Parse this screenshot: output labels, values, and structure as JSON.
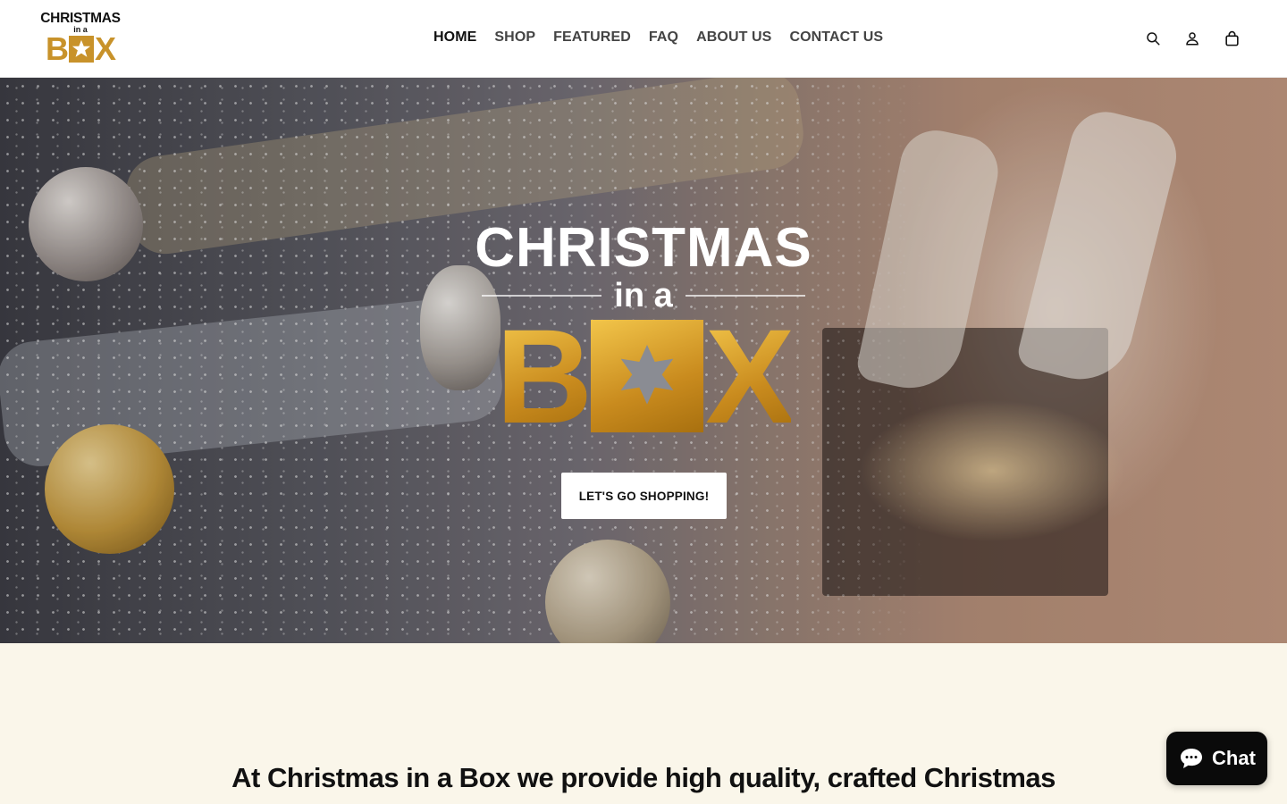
{
  "brand": {
    "logo_line1": "CHRISTMAS",
    "logo_line2": "in a",
    "logo_box_left": "B",
    "logo_box_right": "X",
    "gold_color": "#c8922a"
  },
  "nav": {
    "items": [
      {
        "label": "HOME",
        "active": true
      },
      {
        "label": "SHOP"
      },
      {
        "label": "FEATURED"
      },
      {
        "label": "FAQ"
      },
      {
        "label": "ABOUT US"
      },
      {
        "label": "CONTACT US"
      }
    ]
  },
  "header_icons": [
    "search-icon",
    "account-icon",
    "cart-icon"
  ],
  "hero": {
    "title": "CHRISTMAS",
    "subtitle": "in a",
    "box_left": "B",
    "box_right": "X",
    "cta_label": "LET'S GO SHOPPING!"
  },
  "intro": {
    "text": "At Christmas in a Box we provide high quality, crafted Christmas"
  },
  "chat": {
    "label": "Chat",
    "background": "#0a0a0a"
  }
}
